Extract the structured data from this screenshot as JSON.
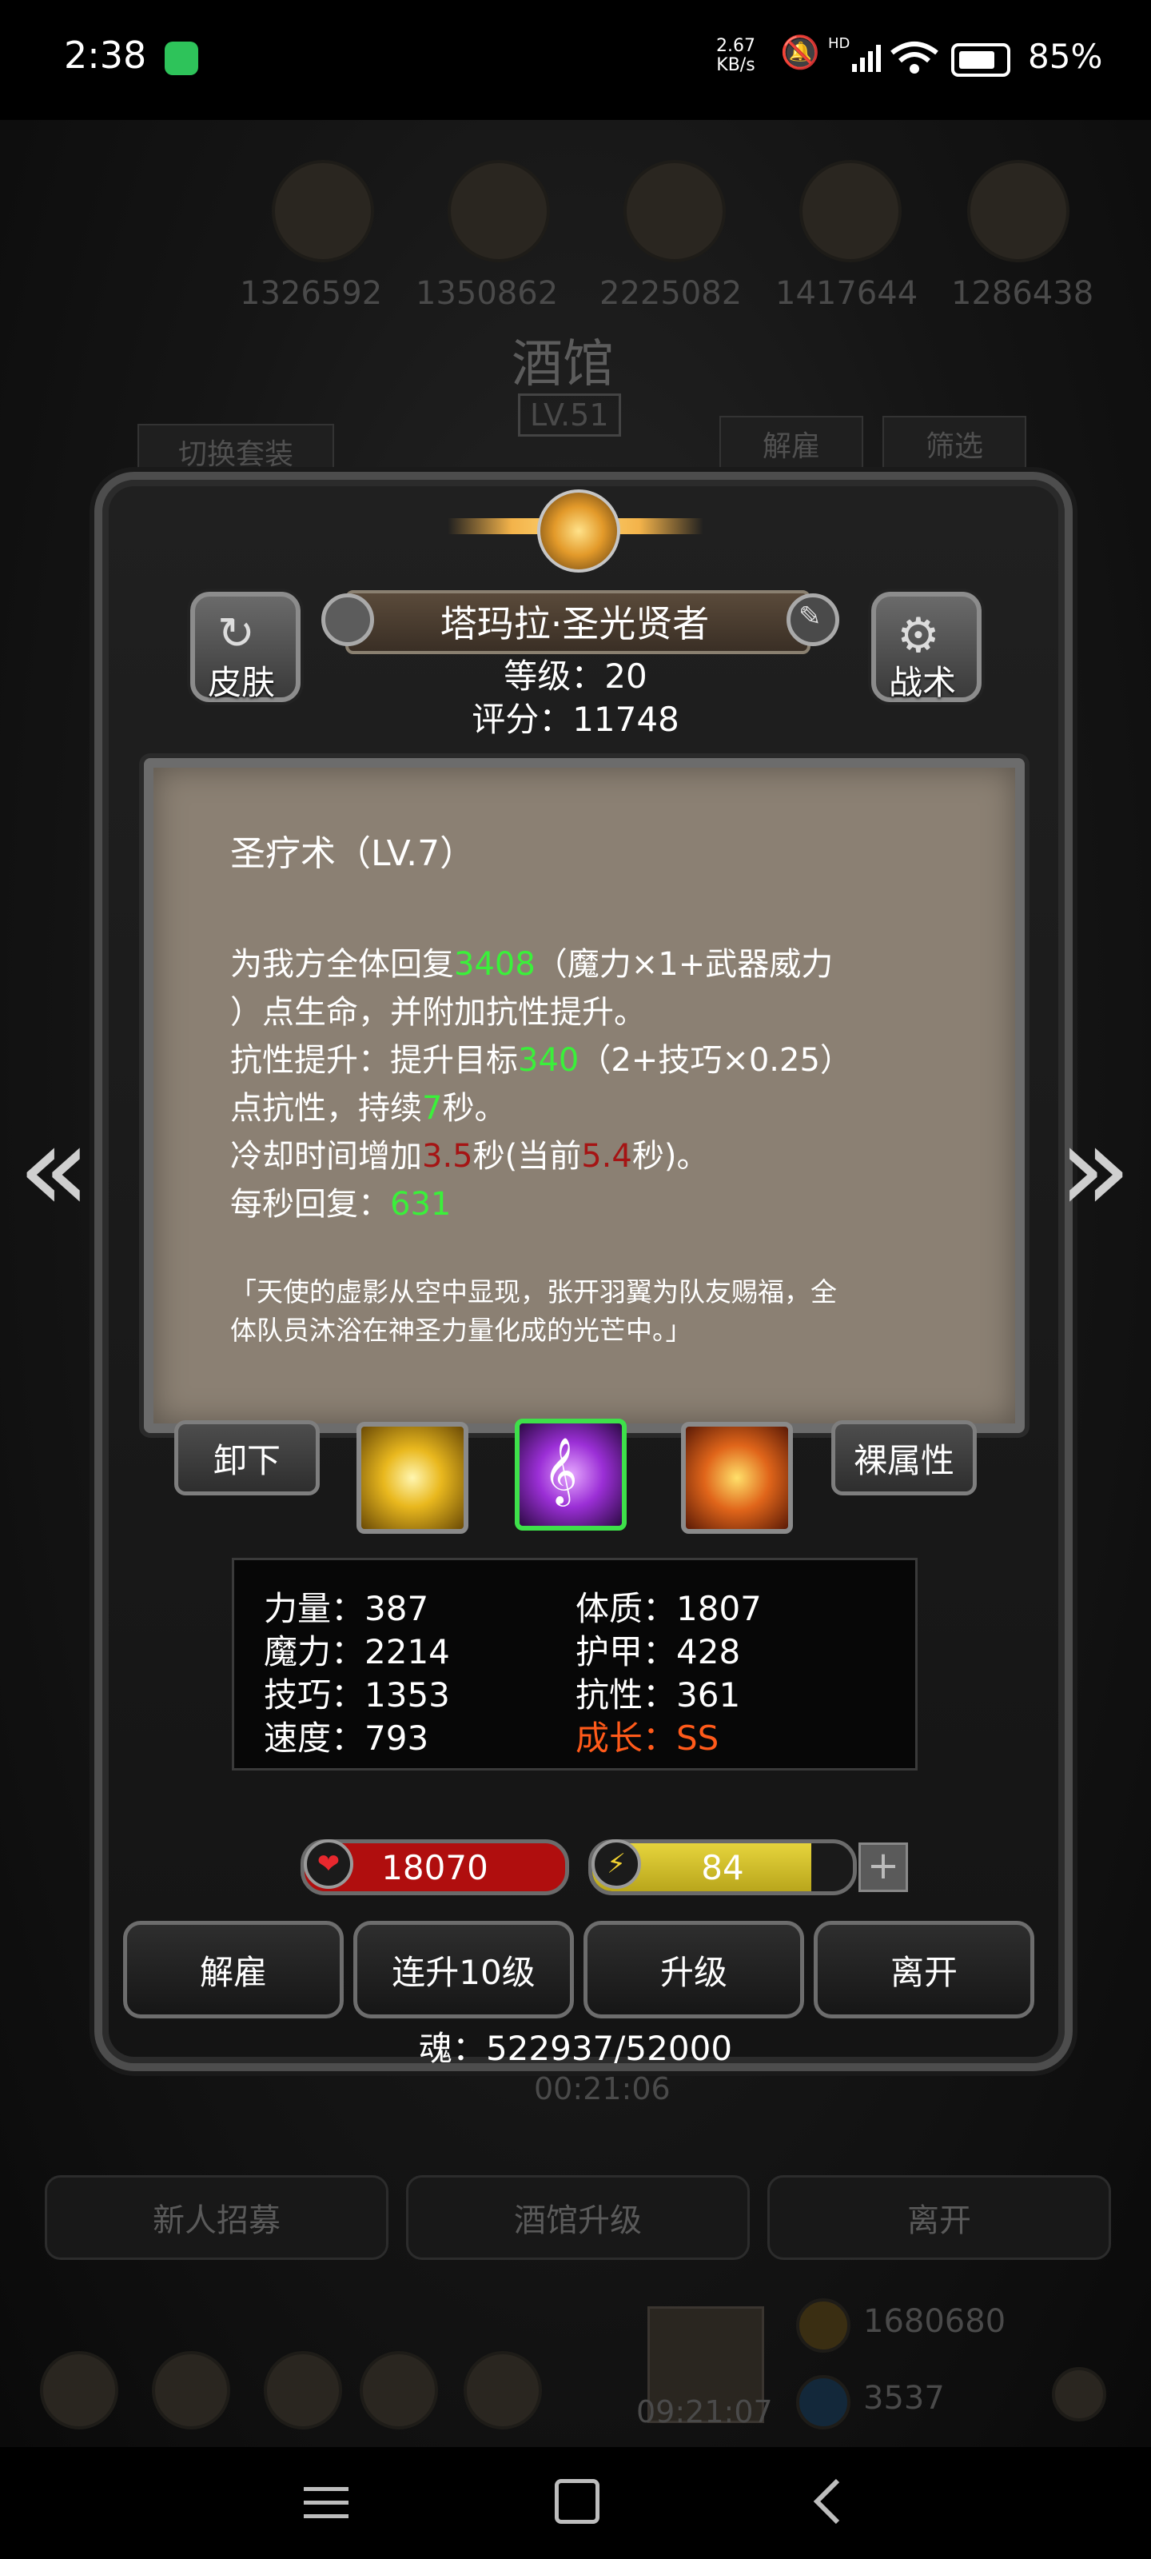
{
  "status_bar": {
    "time": "2:38",
    "net_speed_top": "2.67",
    "net_speed_unit": "KB/s",
    "hd": "HD",
    "battery": "85%"
  },
  "background": {
    "resource_values": [
      "1326592",
      "1350862",
      "2225082",
      "1417644",
      "1286438"
    ],
    "title": "酒馆",
    "level": "LV.51",
    "switch_outfit": "切换套装",
    "dismiss": "解雇",
    "filter": "筛选",
    "timer_top": "00:21:06",
    "buttons": [
      "新人招募",
      "酒馆升级",
      "离开"
    ],
    "gold": "1680680",
    "gems": "3537",
    "timer_bottom": "09:21:07"
  },
  "hero": {
    "name": "塔玛拉·圣光贤者",
    "level_line": "等级：20",
    "score_line": "评分：11748",
    "skin_label": "皮肤",
    "tactics_label": "战术"
  },
  "skill": {
    "title": "圣疗术（LV.7）",
    "line1_a": "为我方全体回复",
    "line1_val": "3408",
    "line1_b": "（魔力×1+武器威力",
    "line2": "）点生命，并附加抗性提升。",
    "line3_a": "抗性提升：提升目标",
    "line3_val": "340",
    "line3_b": "（2+技巧×0.25）",
    "line4_a": "点抗性，持续",
    "line4_val": "7",
    "line4_b": "秒。",
    "line5_a": "冷却时间增加",
    "line5_val": "3.5",
    "line5_b": "秒(当前",
    "line5_val2": "5.4",
    "line5_c": "秒)。",
    "line6_a": "每秒回复：",
    "line6_val": "631",
    "flavor1": "「天使的虚影从空中显现，张开羽翼为队友赐福，全",
    "flavor2": "体队员沐浴在神圣力量化成的光芒中。」"
  },
  "skill_row": {
    "unequip": "卸下",
    "naked_attr": "裸属性"
  },
  "stats": {
    "strength": "力量：387",
    "magic": "魔力：2214",
    "skill": "技巧：1353",
    "speed": "速度：793",
    "constitution": "体质：1807",
    "armor": "护甲：428",
    "resistance": "抗性：361",
    "growth": "成长：SS"
  },
  "bars": {
    "hp": "18070",
    "energy": "84",
    "energy_fraction": 0.84,
    "plus": "+"
  },
  "actions": {
    "dismiss": "解雇",
    "level10": "连升10级",
    "upgrade": "升级",
    "leave": "离开"
  },
  "soul": "魂：522937/52000",
  "colors": {
    "value_green": "#3af03a",
    "value_red": "#a51414",
    "growth_orange": "#ff5a1a",
    "hp_red": "#b00e0e",
    "energy_yellow": "#e6d43c"
  },
  "icons": {
    "nav": [
      "menu-icon",
      "home-square-icon",
      "back-chevron-icon"
    ],
    "status": [
      "wechat-icon",
      "mute-bell-icon",
      "signal-icon",
      "wifi-icon",
      "battery-icon"
    ]
  }
}
